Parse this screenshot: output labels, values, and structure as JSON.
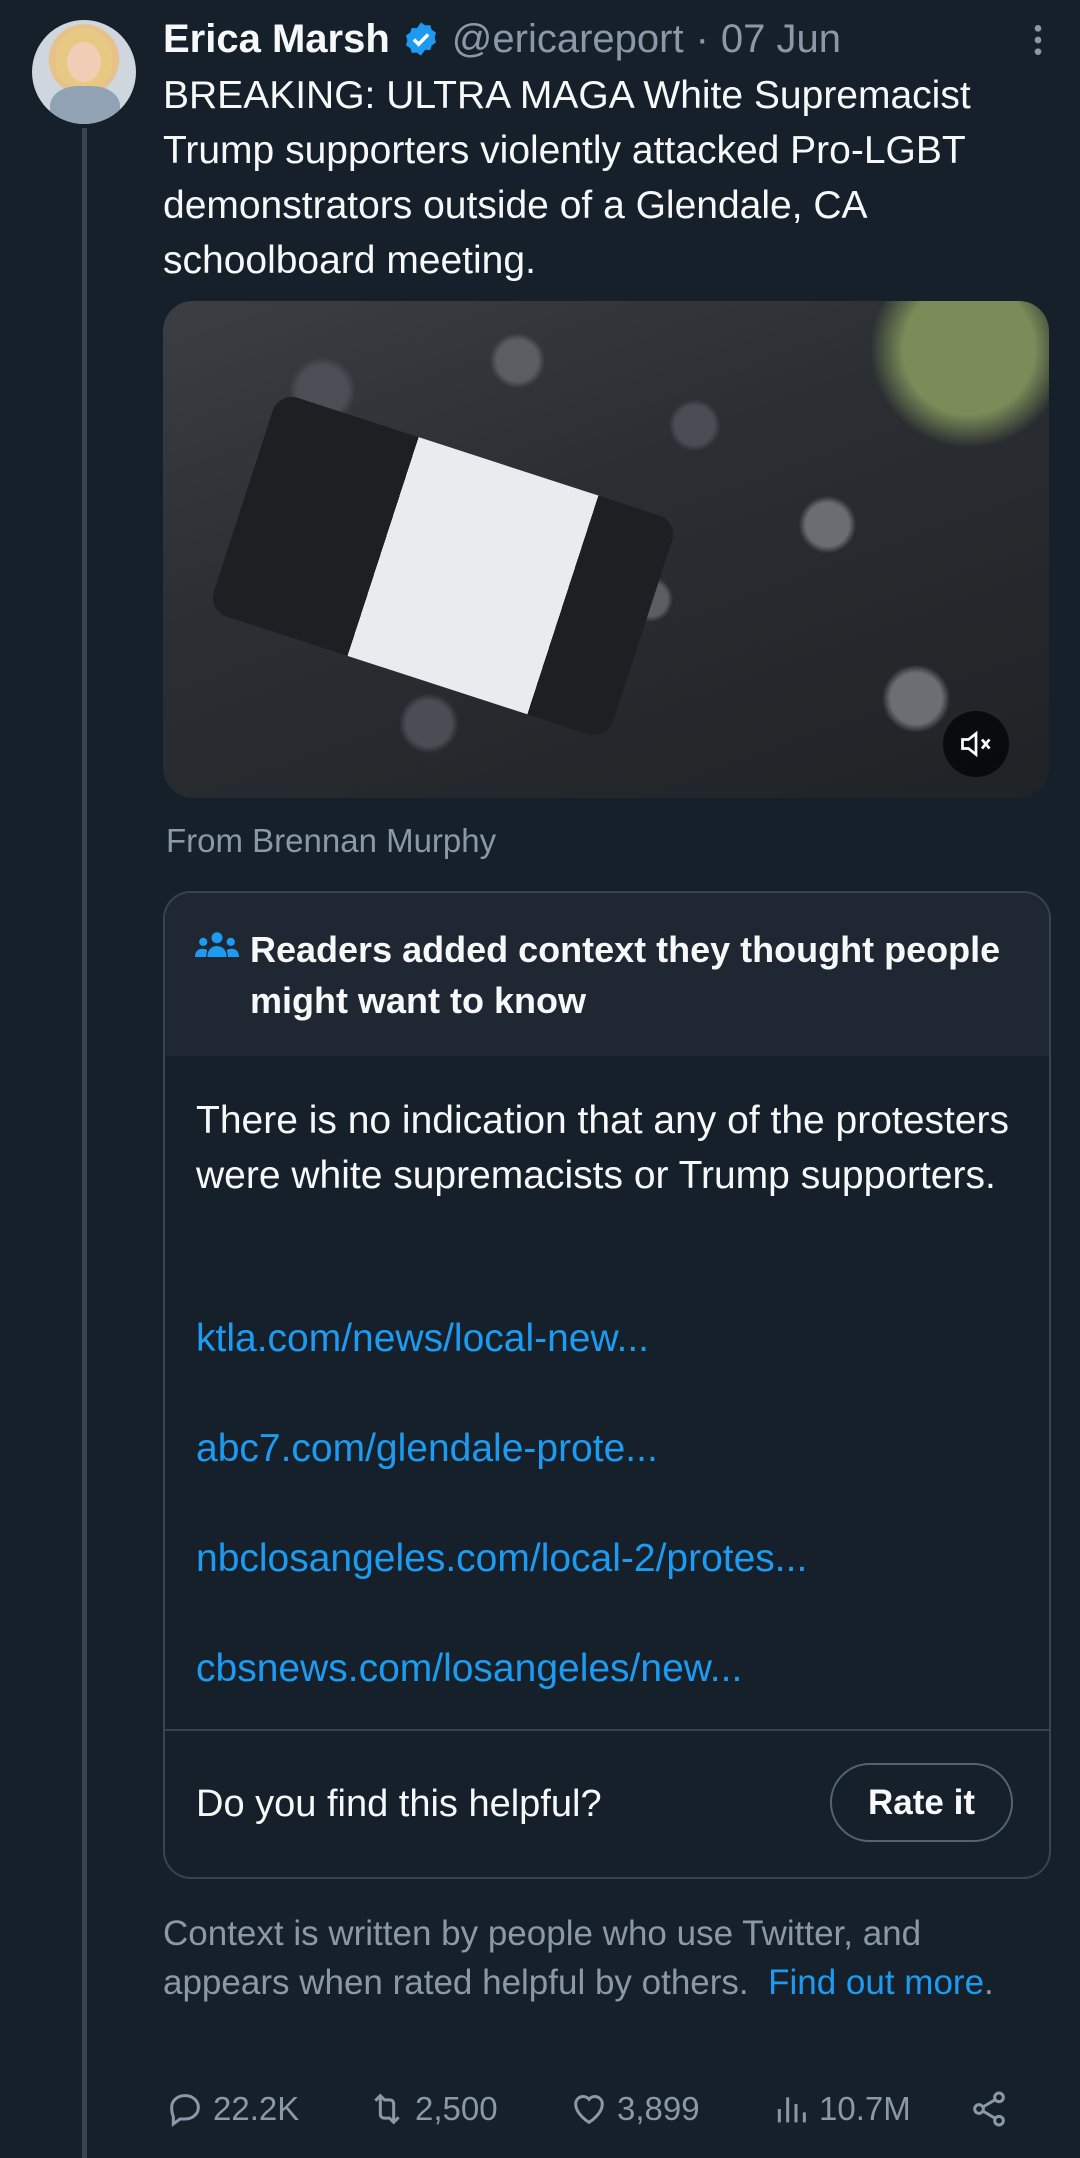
{
  "tweet": {
    "author_name": "Erica Marsh",
    "handle": "@ericareport",
    "separator": "·",
    "date": "07 Jun",
    "text": "BREAKING: ULTRA MAGA White Supremacist Trump supporters violently attacked Pro-LGBT demonstrators outside of a Glendale, CA schoolboard meeting.",
    "media_source": "From Brennan Murphy"
  },
  "community_note": {
    "title": "Readers added context they thought people might want to know",
    "body": "There is no indication that any of the protesters were white supremacists or Trump supporters.",
    "links": [
      "ktla.com/news/local-new...",
      "abc7.com/glendale-prote...",
      "nbclosangeles.com/local-2/protes...",
      "cbsnews.com/losangeles/new..."
    ],
    "helpful_question": "Do you find this helpful?",
    "rate_label": "Rate it"
  },
  "context_footer": {
    "text": "Context is written by people who use Twitter, and appears when rated helpful by others.",
    "link": "Find out more",
    "trailing": "."
  },
  "actions": {
    "replies": "22.2K",
    "retweets": "2,500",
    "likes": "3,899",
    "views": "10.7M"
  },
  "colors": {
    "background": "#15202b",
    "accent_blue": "#1d9bf0",
    "secondary_text": "#8b98a5",
    "border": "#38444d"
  },
  "icons": [
    "verified-badge-icon",
    "more-options-icon",
    "mute-icon",
    "community-notes-icon",
    "reply-icon",
    "retweet-icon",
    "like-icon",
    "views-icon",
    "share-icon"
  ]
}
